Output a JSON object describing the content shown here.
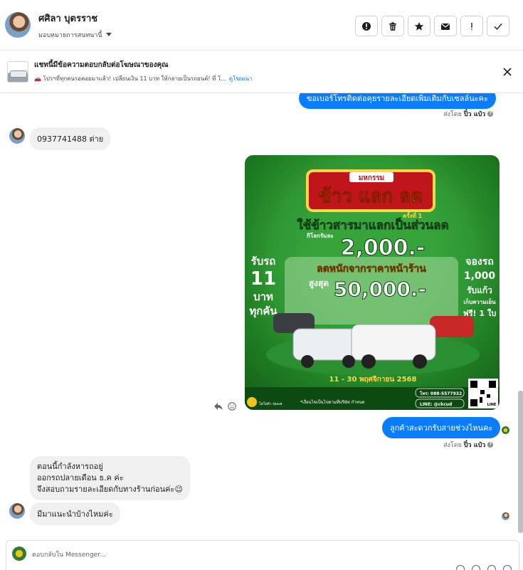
{
  "header": {
    "contact_name": "ศศิลา บุตรราช",
    "assign_label": "มอบหมายการสนทนานี้"
  },
  "ad_banner": {
    "title": "แชทนี้มีข้อความตอบกลับต่อโฆษณาของคุณ",
    "preview": "🚗 โปรฯที่ทุกคนรอคอยมาแล้ว! เปลี่ยนเงิน 11 บาท ให้กลายเป็นรถยนต์! ที่ โ...",
    "link": "ดูโฆษณา"
  },
  "messages": {
    "out_top_partial": "ขอเบอร์โทรติดต่อคุยรายละเอียดเพิ่มเติมกับเซลล์นะคะ",
    "sent_by_prefix": "ส่งโดย",
    "sent_by_name": "ปิ๋ว แป๋ว",
    "in_phone": "0937741488 ต่าย",
    "out_question": "ลูกค้าสะดวกรับสายช่วงไหนคะ",
    "in_reply_line1": "ตอนนี้กำลังหารถอยู่",
    "in_reply_line2": "ออกรถปลายเดือน ธ.ค ค่ะ",
    "in_reply_line3": "จึงสอบถามรายละเอียดกับทางร้านก่อนค่ะ😉",
    "in_last": "มีมาแนะนำบ้างไหมค่ะ"
  },
  "promo": {
    "event": "มหกรรม",
    "headline": "ข้าว แลก ลด",
    "first_time": "ครั้งที่ 1",
    "use_rice": "ใช้ข้าวสารมาแลกเป็นส่วนลด",
    "per_kg": "กิโลกรัมละ",
    "per_kg_value": "2,000.-",
    "left_1": "รับรถ",
    "left_2": "11",
    "left_3": "บาท",
    "left_4": "ทุกคัน",
    "right_1": "จองรถ",
    "right_2": "1,000",
    "right_3": "รับแก้ว",
    "right_4": "เก็บความเย็น",
    "right_5": "ฟรี! 1 ใบ",
    "discount_label": "ลดหนักจากราคาหน้าร้าน",
    "max_label": "สูงสุด",
    "max_value": "50,000.-",
    "date": "11 - 30 พฤศจิกายน 2568",
    "phone": "โทร: 088-5577932",
    "line": "LINE: @ckcud",
    "note": "*เงื่อนไขเป็นไปตามที่บริษัท กำหนด",
    "dealer": "โตโยต้า ชุมแพ",
    "qr_label": "LINE"
  },
  "composer": {
    "placeholder": "ตอบกลับใน Messenger..."
  },
  "colors": {
    "messenger_blue": "#0a7cff",
    "incoming_gray": "#f0f0f0",
    "promo_green": "#1f7d23"
  }
}
